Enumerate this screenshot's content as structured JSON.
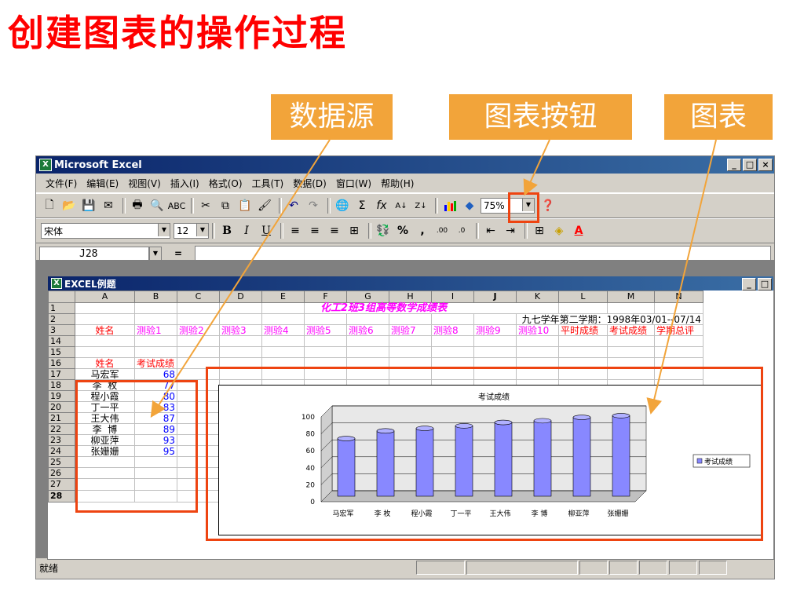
{
  "slide": {
    "title": "创建图表的操作过程",
    "callouts": {
      "data_source": "数据源",
      "chart_button": "图表按钮",
      "chart": "图表"
    }
  },
  "window": {
    "title": "Microsoft Excel",
    "menu": [
      "文件(F)",
      "编辑(E)",
      "视图(V)",
      "插入(I)",
      "格式(O)",
      "工具(T)",
      "数据(D)",
      "窗口(W)",
      "帮助(H)"
    ],
    "zoom": "75%",
    "font_name": "宋体",
    "font_size": "12",
    "name_box": "J28",
    "formula_eq": "=",
    "status": "就绪"
  },
  "workbook": {
    "title": "EXCEL例题",
    "columns": [
      "A",
      "B",
      "C",
      "D",
      "E",
      "F",
      "G",
      "H",
      "I",
      "J",
      "K",
      "L",
      "M",
      "N"
    ],
    "row1_title": "化工2班3组高等数学成绩表",
    "row2_semester": "九七学年第二学期：1998年03/01--07/14",
    "row3_headers": [
      "姓名",
      "测验1",
      "测验2",
      "测验3",
      "测验4",
      "测验5",
      "测验6",
      "测验7",
      "测验8",
      "测验9",
      "测验10",
      "平时成绩",
      "考试成绩",
      "学期总评"
    ],
    "data_header": {
      "name": "姓名",
      "score": "考试成绩"
    },
    "students": [
      {
        "row": "17",
        "name": "马宏军",
        "score": "68"
      },
      {
        "row": "18",
        "name": "李  枚",
        "score": "77"
      },
      {
        "row": "19",
        "name": "程小霞",
        "score": "80"
      },
      {
        "row": "20",
        "name": "丁一平",
        "score": "83"
      },
      {
        "row": "21",
        "name": "王大伟",
        "score": "87"
      },
      {
        "row": "22",
        "name": "李  博",
        "score": "89"
      },
      {
        "row": "23",
        "name": "柳亚萍",
        "score": "93"
      },
      {
        "row": "24",
        "name": "张姗姗",
        "score": "95"
      }
    ]
  },
  "chart_data": {
    "type": "bar",
    "title": "考试成绩",
    "categories": [
      "马宏军",
      "李  枚",
      "程小霞",
      "丁一平",
      "王大伟",
      "李  博",
      "柳亚萍",
      "张姗姗"
    ],
    "series": [
      {
        "name": "考试成绩",
        "values": [
          68,
          77,
          80,
          83,
          87,
          89,
          93,
          95
        ]
      }
    ],
    "ylim": [
      0,
      100
    ],
    "yticks": [
      "0",
      "20",
      "40",
      "60",
      "80",
      "100"
    ],
    "legend": "right",
    "bar_color": "#8888ff",
    "accent": "#ee4411"
  }
}
